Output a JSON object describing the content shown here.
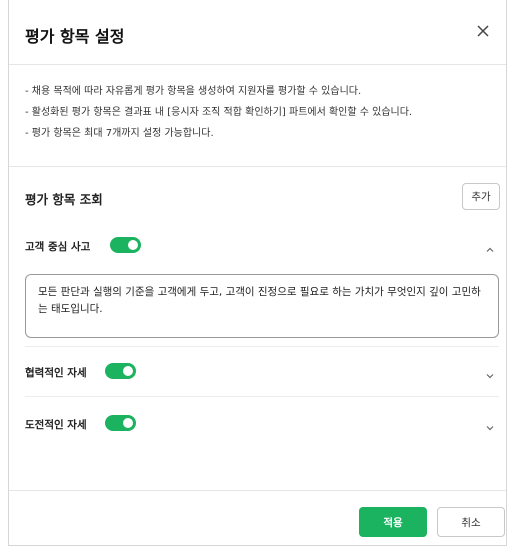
{
  "dialog": {
    "title": "평가 항목 설정"
  },
  "notice": {
    "lines": [
      "- 채용 목적에 따라 자유롭게 평가 항목을 생성하여 지원자를 평가할 수 있습니다.",
      "- 활성화된 평가 항목은 결과표 내 [응시자 조직 적합 확인하기] 파트에서 확인할 수 있습니다.",
      "- 평가 항목은 최대 7개까지 설정 가능합니다."
    ]
  },
  "section": {
    "title": "평가 항목 조회",
    "add_label": "추가"
  },
  "items": [
    {
      "label": "고객 중심 사고",
      "enabled": true,
      "expanded": true,
      "description": "모든 판단과 실행의 기준을 고객에게 두고, 고객이 진정으로 필요로 하는 가치가 무엇인지 깊이 고민하는 태도입니다."
    },
    {
      "label": "협력적인 자세",
      "enabled": true,
      "expanded": false
    },
    {
      "label": "도전적인 자세",
      "enabled": true,
      "expanded": false
    }
  ],
  "footer": {
    "apply_label": "적용",
    "cancel_label": "취소"
  },
  "colors": {
    "accent": "#1bb35f",
    "border": "#c8c8c8"
  },
  "icons": {
    "close": "close-icon",
    "expand": "chevron-down-icon",
    "collapse": "chevron-up-icon"
  }
}
